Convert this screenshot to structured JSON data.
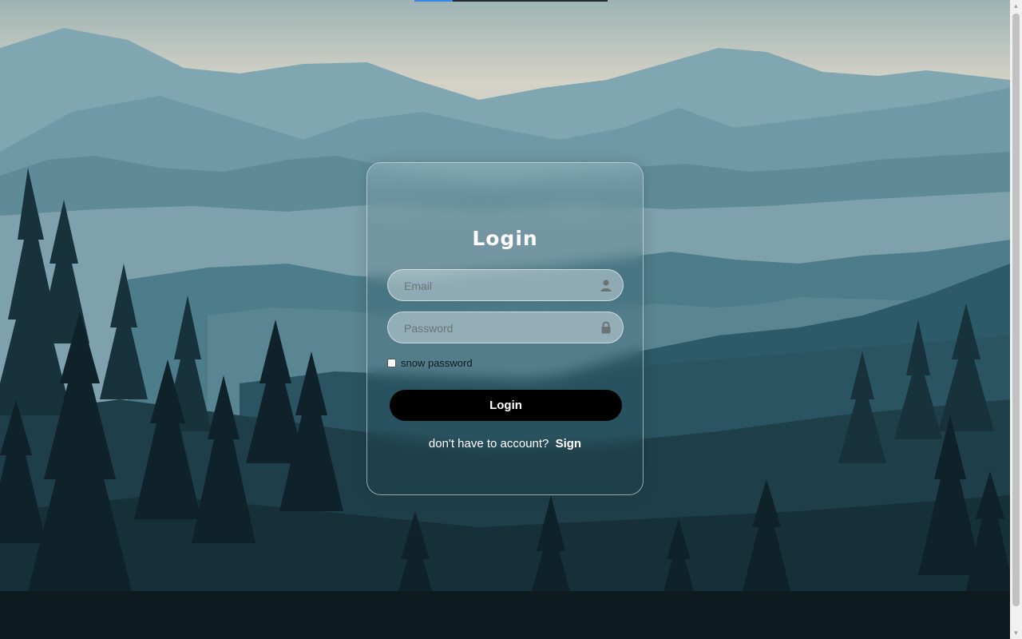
{
  "page": {
    "title": "Login",
    "email_placeholder": "Email",
    "password_placeholder": "Password",
    "show_password_label": "snow password",
    "show_password_checked": false,
    "login_button": "Login",
    "signup_prompt": "don't have to account?",
    "signup_link": "Sign"
  },
  "icons": {
    "email": "user-icon",
    "password": "lock-icon"
  },
  "top_progress": {
    "value": 0.2
  },
  "colors": {
    "button_bg": "#000000",
    "text_light": "#ffffff",
    "sky_top": "#9fb6b5",
    "horizon": "#d6d3c8",
    "forest_dark": "#0e1c22"
  }
}
